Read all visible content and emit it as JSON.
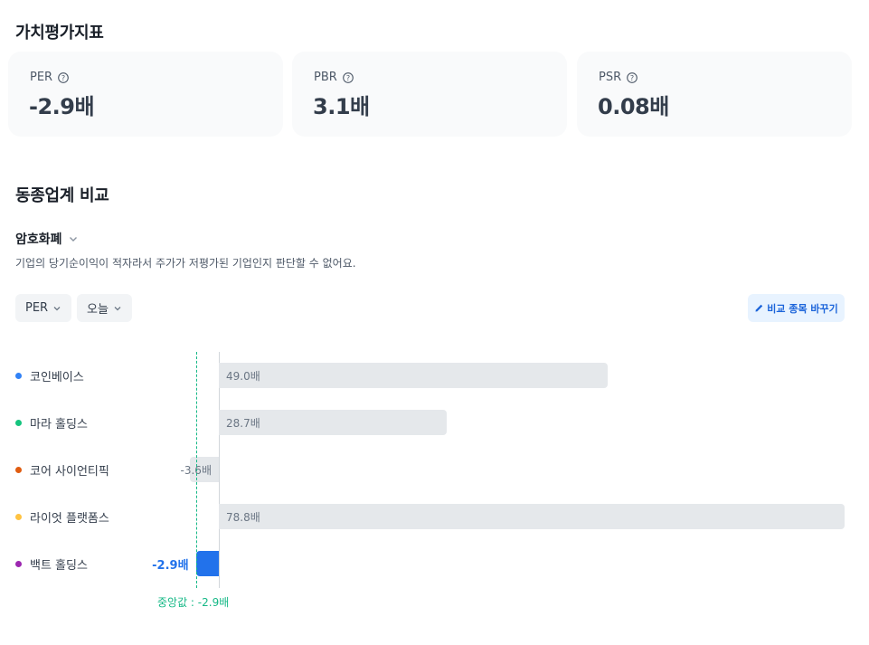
{
  "valuation": {
    "title": "가치평가지표",
    "cards": [
      {
        "label": "PER",
        "value": "-2.9배"
      },
      {
        "label": "PBR",
        "value": "3.1배"
      },
      {
        "label": "PSR",
        "value": "0.08배"
      }
    ]
  },
  "peer": {
    "title": "동종업계 비교",
    "industry": "암호화폐",
    "description": "기업의 당기순이익이 적자라서 주가가 저평가된 기업인지 판단할 수 없어요.",
    "filters": {
      "metric": "PER",
      "period": "오늘"
    },
    "change_button": "비교 종목 바꾸기",
    "rows": [
      {
        "name": "코인베이스",
        "value": 49.0,
        "value_label": "49.0배",
        "color": "#3182f6",
        "highlight": false
      },
      {
        "name": "마라 홀딩스",
        "value": 28.7,
        "value_label": "28.7배",
        "color": "#15c47e",
        "highlight": false
      },
      {
        "name": "코어 사이언티픽",
        "value": -3.6,
        "value_label": "-3.6배",
        "color": "#e05c10",
        "highlight": false
      },
      {
        "name": "라이엇 플랫폼스",
        "value": 78.8,
        "value_label": "78.8배",
        "color": "#ffc342",
        "highlight": false
      },
      {
        "name": "백트 홀딩스",
        "value": -2.9,
        "value_label": "-2.9배",
        "color": "#9c27b0",
        "highlight": true
      }
    ],
    "median_label": "중앙값 : -2.9배",
    "median_value": -2.9
  },
  "colors": {
    "highlight_bar": "#2272eb",
    "median": "#15b886"
  }
}
